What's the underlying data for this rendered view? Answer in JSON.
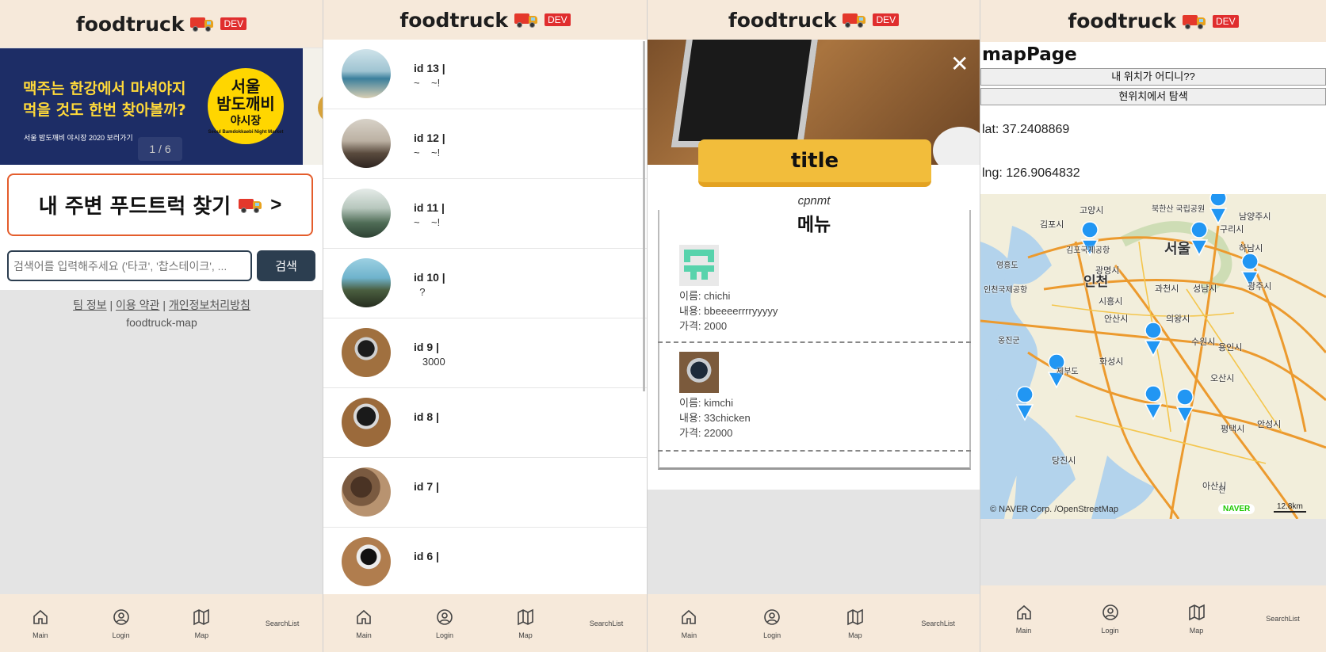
{
  "brand": {
    "name": "foodtruck",
    "badge": "DEV"
  },
  "nav": {
    "main": "Main",
    "login": "Login",
    "map": "Map",
    "search_list": "SearchList"
  },
  "home": {
    "banner": {
      "line1": "맥주는 한강에서 마셔야지",
      "line2": "먹을 것도 한번 찾아볼까?",
      "line3": "서울 밤도깨비 야시장 2020 보러가기",
      "logo_top": "서울",
      "logo_mid": "밤도깨비",
      "logo_bottom": "야시장",
      "logo_sub": "Seoul Bamdokkaebi Night Market",
      "counter": "1 / 6"
    },
    "find_button": "내 주변 푸드트럭 찾기",
    "find_arrow": ">",
    "search_placeholder": "검색어를 입력해주세요 ('타코', '찹스테이크', ...",
    "search_button": "검색",
    "links": {
      "team": "팀 정보",
      "terms": "이용 약관",
      "privacy": "개인정보처리방침",
      "sep": "|",
      "sub": "foodtruck-map"
    }
  },
  "list": {
    "rows": [
      {
        "id": "id 13 |",
        "sub": "~    ~!",
        "img": "sea"
      },
      {
        "id": "id 12 |",
        "sub": "~    ~!",
        "img": "rock"
      },
      {
        "id": "id 11 |",
        "sub": "~    ~!",
        "img": "fog"
      },
      {
        "id": "id 10 |",
        "sub": "  ?",
        "img": "field"
      },
      {
        "id": "id 9 |",
        "sub": "   3000",
        "img": "laptop"
      },
      {
        "id": "id 8 |",
        "sub": "",
        "img": "laptop2"
      },
      {
        "id": "id 7 |",
        "sub": "",
        "img": "desk"
      },
      {
        "id": "id 6 |",
        "sub": "",
        "img": "laptop3"
      }
    ]
  },
  "detail": {
    "close": "✕",
    "title": "title",
    "cpnmt": "cpnmt",
    "menu_heading": "메뉴",
    "items": [
      {
        "name": "이름: chichi",
        "content": "내용: bbeeeerrrryyyyy",
        "price": "가격: 2000",
        "img": "green-icon"
      },
      {
        "name": "이름: kimchi",
        "content": "내용: 33chicken",
        "price": "가격: 22000",
        "img": "laptop-photo"
      }
    ]
  },
  "mapPage": {
    "title": "mapPage",
    "btn_where": "내 위치가 어디니??",
    "btn_search": "현위치에서 탐색",
    "lat": "lat: 37.2408869",
    "lng": "lng: 126.9064832",
    "credit": "© NAVER Corp. /OpenStreetMap",
    "naver": "NAVER",
    "scale": "12.8km",
    "labels": [
      "서울",
      "인천",
      "김포시",
      "고양시",
      "남양주시",
      "구리시",
      "하남시",
      "광명시",
      "시흥시",
      "과천시",
      "성남시",
      "광주시",
      "안산시",
      "의왕시",
      "수원시",
      "용인시",
      "화성시",
      "오산시",
      "평택시",
      "안성시",
      "당진시",
      "아산시",
      "영흥도",
      "옹진군",
      "제부도",
      "인천국제공항",
      "북한산 국립공원",
      "김포국제공항",
      "천"
    ]
  }
}
